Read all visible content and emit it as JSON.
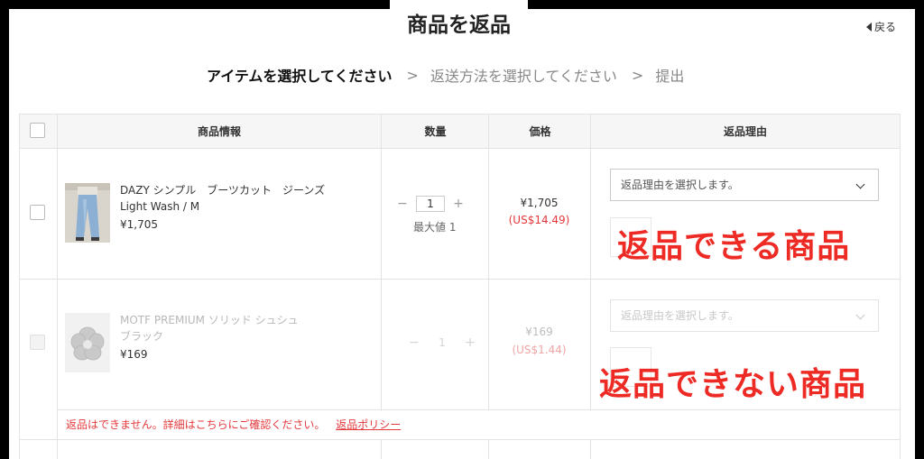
{
  "header": {
    "title": "商品を返品",
    "back_label": "戻る"
  },
  "steps": [
    {
      "label": "アイテムを選択してください",
      "state": "active"
    },
    {
      "label": "返送方法を選択してください",
      "state": "inactive"
    },
    {
      "label": "提出",
      "state": "inactive"
    }
  ],
  "step_separator": ">",
  "table": {
    "columns": [
      "商品情報",
      "数量",
      "価格",
      "返品理由"
    ],
    "rows": [
      {
        "name_line1": "DAZY シンプル　ブーツカット　ジーンズ",
        "name_line2": "Light Wash / M",
        "price": "¥1,705",
        "qty": "1",
        "max_qty_label": "最大値 1",
        "price_jpy": "¥1,705",
        "price_usd": "(US$14.49)",
        "reason_placeholder": "返品理由を選択します。",
        "returnable": true
      },
      {
        "name_line1": "MOTF PREMIUM ソリッド シュシュ",
        "name_line2": "ブラック",
        "price": "¥169",
        "qty": "1",
        "price_jpy": "¥169",
        "price_usd": "(US$1.44)",
        "reason_placeholder": "返品理由を選択します。",
        "returnable": false
      }
    ]
  },
  "notice": {
    "text": "返品はできません。詳細はこちらにご確認ください。",
    "link": "返品ポリシー"
  },
  "annotations": {
    "returnable": "返品できる商品",
    "not_returnable": "返品できない商品"
  },
  "colors": {
    "accent_red": "#e4393c",
    "annotation_red": "#ee2a24"
  }
}
